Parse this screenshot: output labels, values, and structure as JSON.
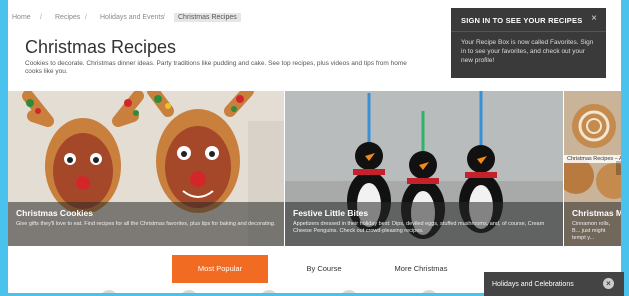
{
  "breadcrumb": {
    "items": [
      "Home",
      "Recipes",
      "Holidays and Events",
      "Christmas Recipes"
    ],
    "separator": "/"
  },
  "page_title": "Christmas Recipes",
  "description": "Cookies to decorate. Christmas dinner ideas. Party traditions like pudding and cake. See top recipes, plus videos and tips from home cooks like you.",
  "signin_popup": {
    "heading": "SIGN IN TO SEE YOUR RECIPES",
    "close": "×",
    "body": "Your Recipe Box is now called Favorites. Sign in to see your favorites, and check out your new profile!"
  },
  "carousel": {
    "slides": [
      {
        "title": "Christmas Cookies",
        "text": "Give gifts they'll love to eat. Find recipes for all the Christmas favorites, plus tips for baking and decorating."
      },
      {
        "title": "Festive Little Bites",
        "text": "Appetizers dressed in their holiday best: Dips, deviled eggs, stuffed mushrooms, and, of course, Cream Cheese Penguins. Check out crowd-pleasing recipes."
      },
      {
        "title": "Christmas Mo",
        "text": "Cinnamon rolls, B... just might tempt y...",
        "tag": "Christmas Recipes – Af"
      }
    ]
  },
  "tabs": [
    "Most Popular",
    "By Course",
    "More Christmas"
  ],
  "active_tab": "Most Popular",
  "holiday_widget": {
    "label": "Holidays and Celebrations",
    "close": "×"
  },
  "colors": {
    "accent": "#f26b22",
    "background": "#49c3ee",
    "popup": "#3a3a3a"
  }
}
